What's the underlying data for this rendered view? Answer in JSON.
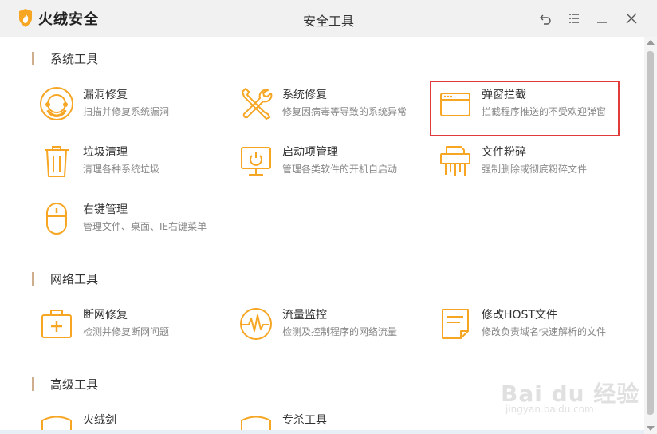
{
  "app": {
    "brand": "火绒安全",
    "window_title": "安全工具"
  },
  "colors": {
    "accent": "#f6a623",
    "highlight": "#e03a3a",
    "section_bar": "#cfae8d"
  },
  "sections": [
    {
      "title": "系统工具",
      "tools": [
        {
          "name": "漏洞修复",
          "desc": "扫描并修复系统漏洞",
          "icon": "bug-repair-icon"
        },
        {
          "name": "系统修复",
          "desc": "修复因病毒等导致的系统异常",
          "icon": "wrench-screwdriver-icon"
        },
        {
          "name": "弹窗拦截",
          "desc": "拦截程序推送的不受欢迎弹窗",
          "icon": "popup-window-icon"
        },
        {
          "name": "垃圾清理",
          "desc": "清理各种系统垃圾",
          "icon": "trash-bin-icon"
        },
        {
          "name": "启动项管理",
          "desc": "管理各类软件的开机自启动",
          "icon": "monitor-power-icon"
        },
        {
          "name": "文件粉碎",
          "desc": "强制删除或彻底粉碎文件",
          "icon": "shredder-icon"
        },
        {
          "name": "右键管理",
          "desc": "管理文件、桌面、IE右键菜单",
          "icon": "mouse-icon"
        }
      ]
    },
    {
      "title": "网络工具",
      "tools": [
        {
          "name": "断网修复",
          "desc": "检测并修复断网问题",
          "icon": "medical-kit-icon"
        },
        {
          "name": "流量监控",
          "desc": "检测及控制程序的网络流量",
          "icon": "pulse-icon"
        },
        {
          "name": "修改HOST文件",
          "desc": "修改负责域名快速解析的文件",
          "icon": "document-icon"
        }
      ]
    },
    {
      "title": "高级工具",
      "tools": [
        {
          "name": "火绒剑",
          "desc": "",
          "icon": "shield-icon"
        },
        {
          "name": "专杀工具",
          "desc": "",
          "icon": "shield-icon"
        }
      ]
    }
  ],
  "watermark": {
    "brand": "Bai du 经验",
    "url": "jingyan.baidu.com"
  }
}
